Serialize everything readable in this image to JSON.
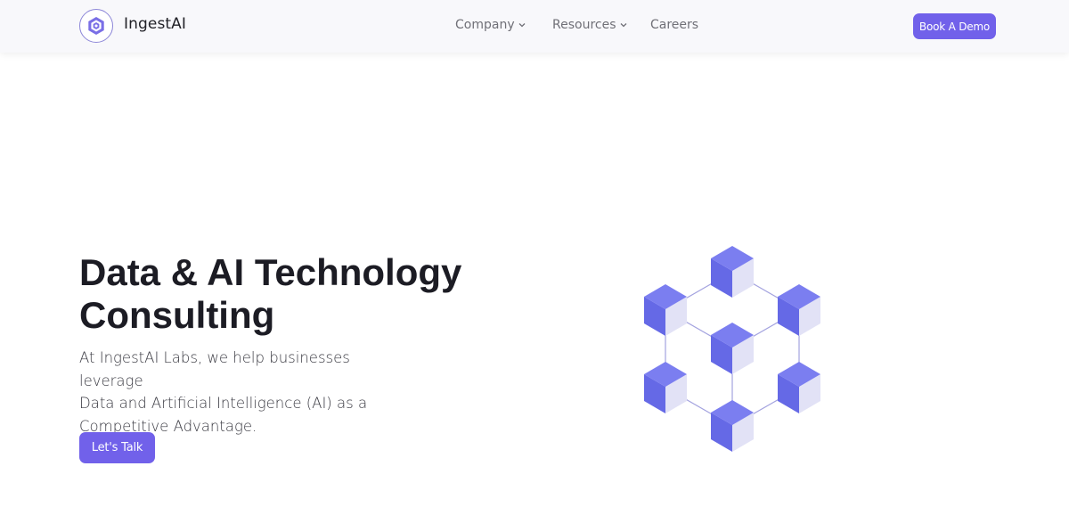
{
  "nav": {
    "brand": "IngestAI",
    "logo_icon": "hexagon-logo-icon",
    "links": [
      {
        "label": "Company",
        "has_dropdown": true
      },
      {
        "label": "Resources",
        "has_dropdown": true
      },
      {
        "label": "Careers",
        "has_dropdown": false
      }
    ],
    "cta": "Book A Demo"
  },
  "hero": {
    "headline_line1": "Data & AI Technology",
    "headline_line2": "Consulting",
    "subtext_line1": "At IngestAI Labs, we help businesses leverage",
    "subtext_line2": "Data and Artificial Intelligence (AI) as a",
    "subtext_line3": "Competitive Advantage.",
    "cta": "Let's Talk",
    "illustration": "cube-network-icon"
  },
  "colors": {
    "accent": "#7161ea",
    "cube_top": "#7b7ef0",
    "cube_left": "#6569e6",
    "cube_right": "#e2e2f6",
    "navbar_bg": "#f8f8fb"
  }
}
